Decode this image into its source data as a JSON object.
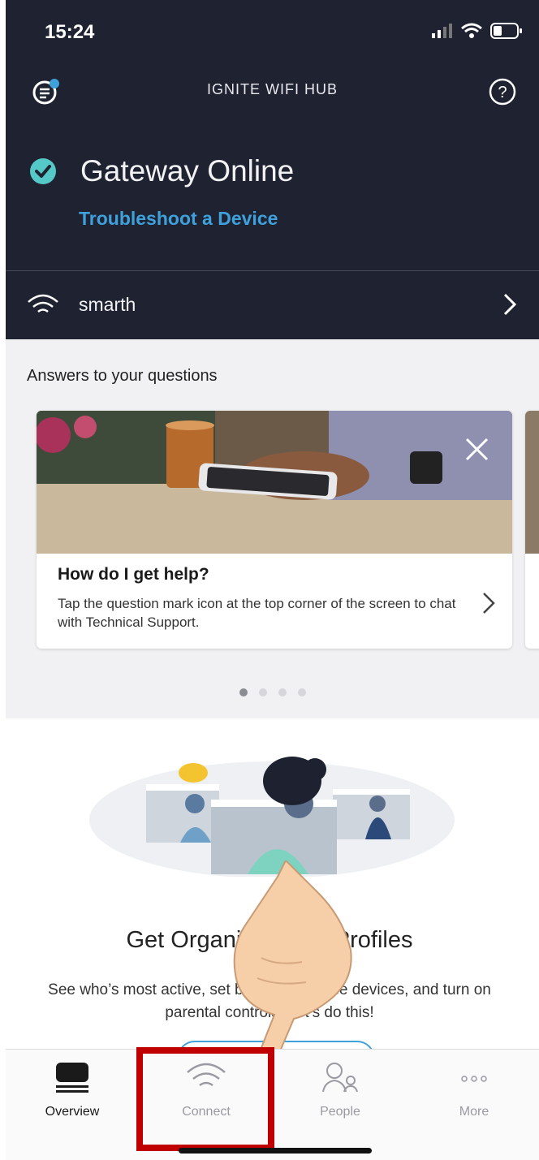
{
  "status_bar": {
    "time": "15:24"
  },
  "header": {
    "title": "IGNITE WIFI HUB"
  },
  "gateway": {
    "status": "Gateway Online",
    "link": "Troubleshoot a Device"
  },
  "network": {
    "name": "smarth"
  },
  "answers": {
    "section_title": "Answers to your questions",
    "card": {
      "title": "How do I get help?",
      "body": "Tap the question mark icon at the top corner of the screen to chat with Technical Support."
    }
  },
  "promo": {
    "title": "Get Organized with Profiles",
    "body": "See who’s most active, set bedtimes, pause devices, and turn on parental controls. Let’s do this!"
  },
  "tabs": [
    {
      "label": "Overview",
      "icon": "router-icon",
      "active": true
    },
    {
      "label": "Connect",
      "icon": "wifi-icon",
      "active": false
    },
    {
      "label": "People",
      "icon": "people-icon",
      "active": false
    },
    {
      "label": "More",
      "icon": "more-icon",
      "active": false
    }
  ],
  "colors": {
    "header_bg": "#1f2230",
    "accent": "#3fa1dc",
    "check": "#55c8c8",
    "highlight": "#c00000"
  }
}
